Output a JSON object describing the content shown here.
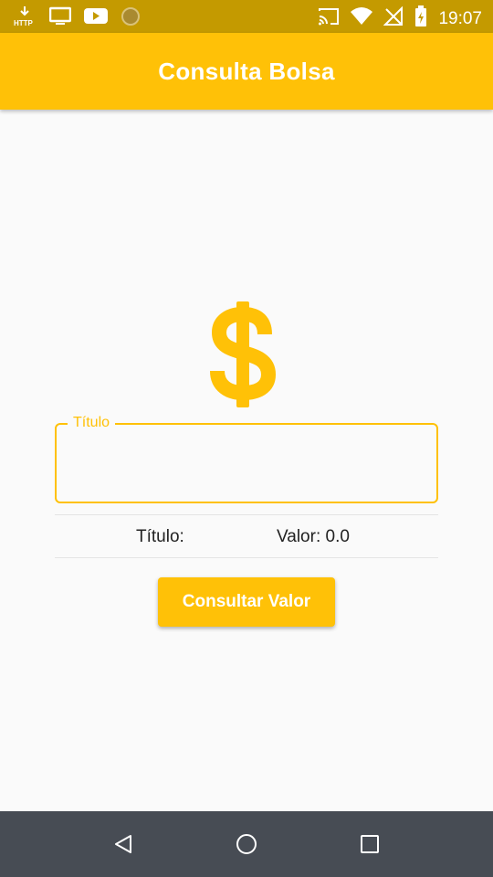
{
  "status_bar": {
    "time": "19:07",
    "left_icons": [
      "http-download-icon",
      "tv-icon",
      "youtube-icon",
      "circle-icon"
    ],
    "right_icons": [
      "cast-icon",
      "wifi-icon",
      "no-signal-icon",
      "battery-icon"
    ]
  },
  "app_bar": {
    "title": "Consulta Bolsa",
    "color": "#ffc107"
  },
  "main": {
    "icon": "dollar-icon",
    "input": {
      "label": "Título",
      "value": ""
    },
    "result": {
      "title_label": "Título:",
      "value_label": "Valor: 0.0"
    },
    "button_label": "Consultar Valor"
  },
  "nav_bar": {
    "icons": [
      "back-icon",
      "home-icon",
      "recents-icon"
    ]
  }
}
